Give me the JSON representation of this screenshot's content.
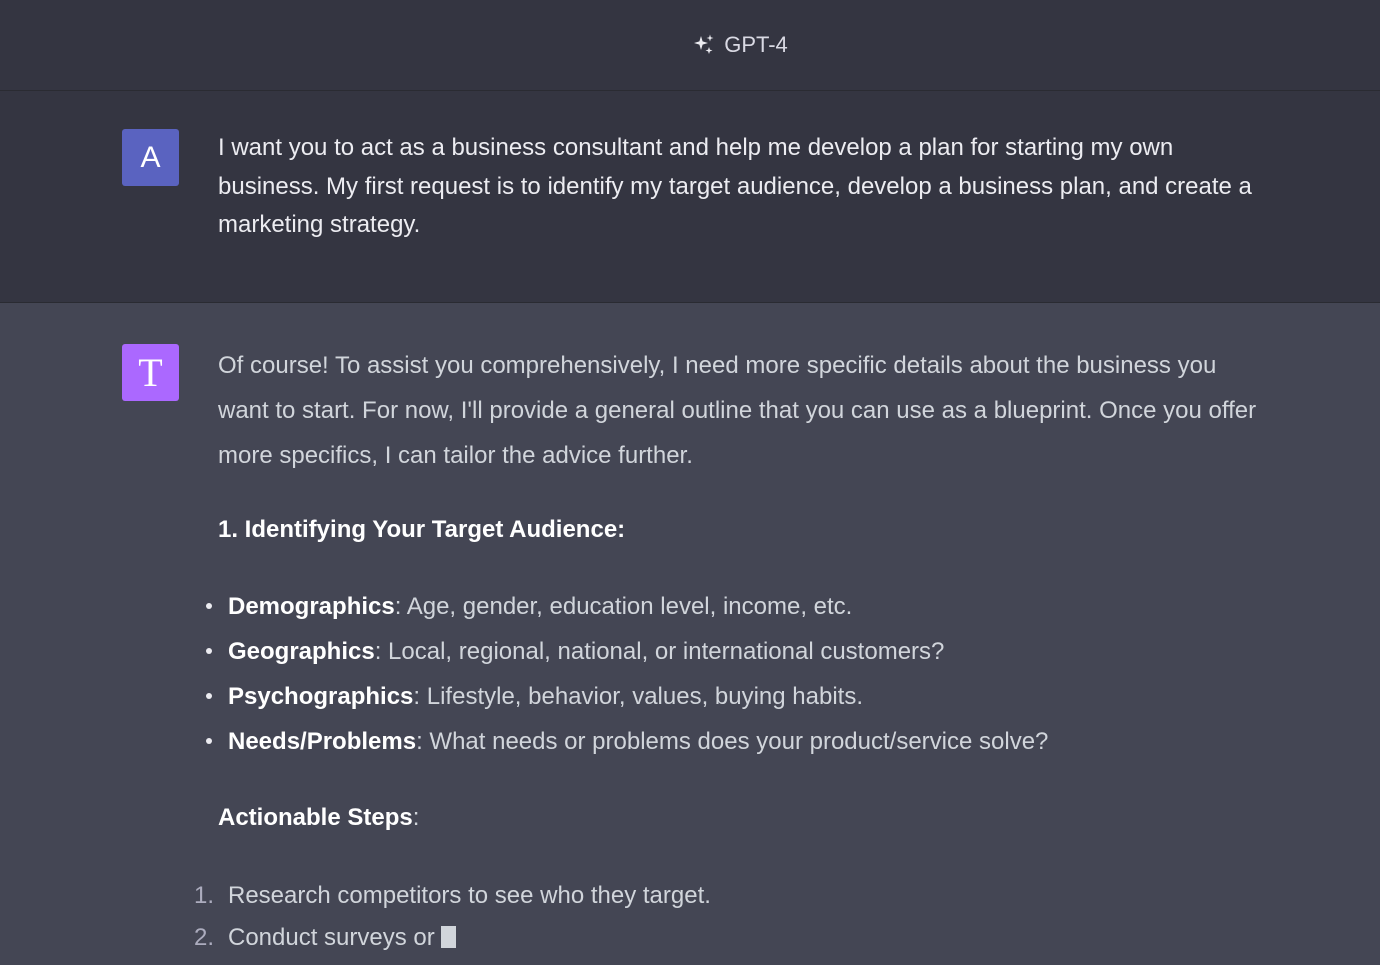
{
  "header": {
    "model_name": "GPT-4",
    "icon": "sparkles-icon"
  },
  "user_message": {
    "avatar_letter": "A",
    "avatar_color": "#5a63c0",
    "text": "I want you to act as a business consultant and help me develop a plan for starting my own business. My first request is to identify my target audience, develop a business plan, and create a marketing strategy."
  },
  "assistant_message": {
    "avatar_letter": "T",
    "avatar_color": "#ab68ff",
    "intro": "Of course! To assist you comprehensively, I need more specific details about the business you want to start. For now, I'll provide a general outline that you can use as a blueprint. Once you offer more specifics, I can tailor the advice further.",
    "section_heading": "1. Identifying Your Target Audience:",
    "bullets": [
      {
        "term": "Demographics",
        "desc": ": Age, gender, education level, income, etc."
      },
      {
        "term": "Geographics",
        "desc": ": Local, regional, national, or international customers?"
      },
      {
        "term": "Psychographics",
        "desc": ": Lifestyle, behavior, values, buying habits."
      },
      {
        "term": "Needs/Problems",
        "desc": ": What needs or problems does your product/service solve?"
      }
    ],
    "subheading": "Actionable Steps",
    "subheading_suffix": ":",
    "steps": [
      {
        "num": "1.",
        "text": "Research competitors to see who they target."
      },
      {
        "num": "2.",
        "text": "Conduct surveys or"
      }
    ]
  }
}
